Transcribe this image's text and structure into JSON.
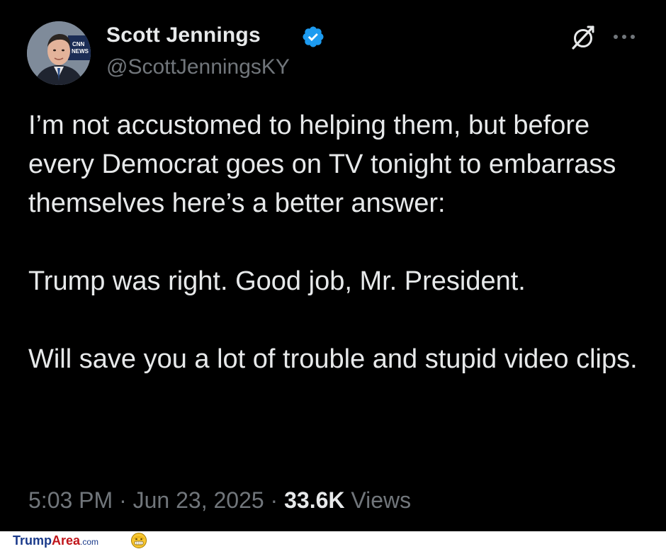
{
  "tweet": {
    "display_name": "Scott Jennings",
    "handle": "@ScottJenningsKY",
    "paragraphs": [
      "I’m not accustomed to helping them, but before every Democrat goes on TV tonight to embarrass themselves here’s a better answer:",
      "Trump was right. Good job, Mr. President.",
      "Will save you a lot of trouble and stupid video clips."
    ],
    "time": "5:03 PM",
    "date": "Jun 23, 2025",
    "separator": "·",
    "views_count": "33.6K",
    "views_label": "Views",
    "verified_color": "#1d9bf0",
    "icons": {
      "avatar": "profile-photo",
      "verified": "verified-badge-icon",
      "grok": "grok-icon",
      "more": "more-options-icon"
    }
  },
  "footer": {
    "brand_trump": "Trump",
    "brand_area": "Area",
    "brand_com": ".com"
  }
}
